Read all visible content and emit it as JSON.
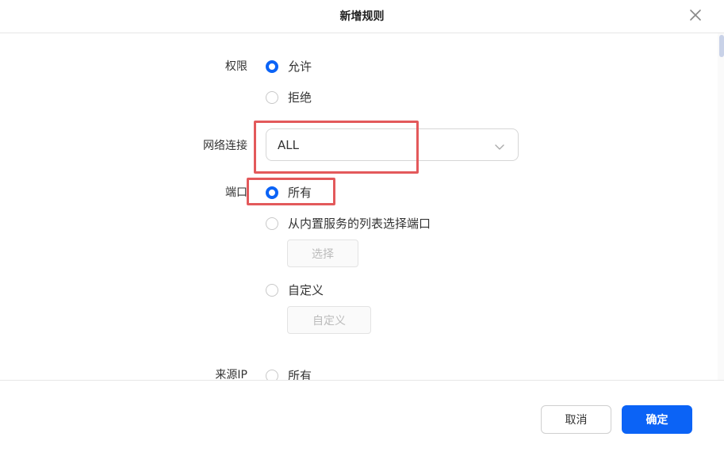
{
  "dialog": {
    "title": "新增规则",
    "close_icon": "close-icon"
  },
  "form": {
    "permission": {
      "label": "权限",
      "options": [
        {
          "label": "允许",
          "checked": true
        },
        {
          "label": "拒绝",
          "checked": false
        }
      ]
    },
    "network": {
      "label": "网络连接",
      "value": "ALL",
      "icon": "chevron-down-icon"
    },
    "port": {
      "label": "端口",
      "options": [
        {
          "label": "所有",
          "checked": true
        },
        {
          "label": "从内置服务的列表选择端口",
          "checked": false
        },
        {
          "label": "自定义",
          "checked": false
        }
      ],
      "select_button": "选择",
      "custom_button": "自定义"
    },
    "source_ip": {
      "label": "来源IP",
      "options": [
        {
          "label": "所有",
          "checked": false
        }
      ]
    }
  },
  "footer": {
    "cancel": "取消",
    "confirm": "确定"
  },
  "colors": {
    "accent": "#0b63f6",
    "highlight": "#e3595b"
  }
}
